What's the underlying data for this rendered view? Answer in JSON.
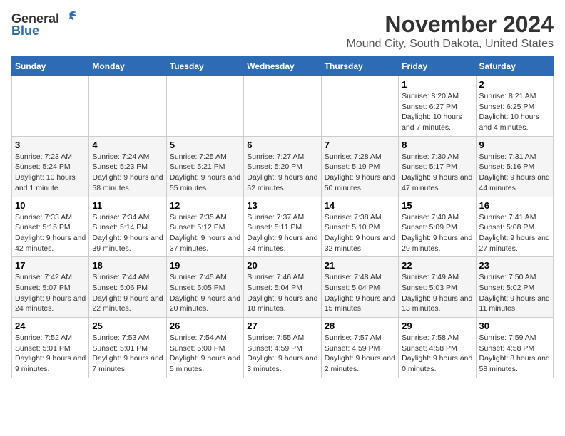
{
  "header": {
    "logo_general": "General",
    "logo_blue": "Blue",
    "month_year": "November 2024",
    "location": "Mound City, South Dakota, United States"
  },
  "weekdays": [
    "Sunday",
    "Monday",
    "Tuesday",
    "Wednesday",
    "Thursday",
    "Friday",
    "Saturday"
  ],
  "weeks": [
    [
      {
        "day": "",
        "info": ""
      },
      {
        "day": "",
        "info": ""
      },
      {
        "day": "",
        "info": ""
      },
      {
        "day": "",
        "info": ""
      },
      {
        "day": "",
        "info": ""
      },
      {
        "day": "1",
        "info": "Sunrise: 8:20 AM\nSunset: 6:27 PM\nDaylight: 10 hours and 7 minutes."
      },
      {
        "day": "2",
        "info": "Sunrise: 8:21 AM\nSunset: 6:25 PM\nDaylight: 10 hours and 4 minutes."
      }
    ],
    [
      {
        "day": "3",
        "info": "Sunrise: 7:23 AM\nSunset: 5:24 PM\nDaylight: 10 hours and 1 minute."
      },
      {
        "day": "4",
        "info": "Sunrise: 7:24 AM\nSunset: 5:23 PM\nDaylight: 9 hours and 58 minutes."
      },
      {
        "day": "5",
        "info": "Sunrise: 7:25 AM\nSunset: 5:21 PM\nDaylight: 9 hours and 55 minutes."
      },
      {
        "day": "6",
        "info": "Sunrise: 7:27 AM\nSunset: 5:20 PM\nDaylight: 9 hours and 52 minutes."
      },
      {
        "day": "7",
        "info": "Sunrise: 7:28 AM\nSunset: 5:19 PM\nDaylight: 9 hours and 50 minutes."
      },
      {
        "day": "8",
        "info": "Sunrise: 7:30 AM\nSunset: 5:17 PM\nDaylight: 9 hours and 47 minutes."
      },
      {
        "day": "9",
        "info": "Sunrise: 7:31 AM\nSunset: 5:16 PM\nDaylight: 9 hours and 44 minutes."
      }
    ],
    [
      {
        "day": "10",
        "info": "Sunrise: 7:33 AM\nSunset: 5:15 PM\nDaylight: 9 hours and 42 minutes."
      },
      {
        "day": "11",
        "info": "Sunrise: 7:34 AM\nSunset: 5:14 PM\nDaylight: 9 hours and 39 minutes."
      },
      {
        "day": "12",
        "info": "Sunrise: 7:35 AM\nSunset: 5:12 PM\nDaylight: 9 hours and 37 minutes."
      },
      {
        "day": "13",
        "info": "Sunrise: 7:37 AM\nSunset: 5:11 PM\nDaylight: 9 hours and 34 minutes."
      },
      {
        "day": "14",
        "info": "Sunrise: 7:38 AM\nSunset: 5:10 PM\nDaylight: 9 hours and 32 minutes."
      },
      {
        "day": "15",
        "info": "Sunrise: 7:40 AM\nSunset: 5:09 PM\nDaylight: 9 hours and 29 minutes."
      },
      {
        "day": "16",
        "info": "Sunrise: 7:41 AM\nSunset: 5:08 PM\nDaylight: 9 hours and 27 minutes."
      }
    ],
    [
      {
        "day": "17",
        "info": "Sunrise: 7:42 AM\nSunset: 5:07 PM\nDaylight: 9 hours and 24 minutes."
      },
      {
        "day": "18",
        "info": "Sunrise: 7:44 AM\nSunset: 5:06 PM\nDaylight: 9 hours and 22 minutes."
      },
      {
        "day": "19",
        "info": "Sunrise: 7:45 AM\nSunset: 5:05 PM\nDaylight: 9 hours and 20 minutes."
      },
      {
        "day": "20",
        "info": "Sunrise: 7:46 AM\nSunset: 5:04 PM\nDaylight: 9 hours and 18 minutes."
      },
      {
        "day": "21",
        "info": "Sunrise: 7:48 AM\nSunset: 5:04 PM\nDaylight: 9 hours and 15 minutes."
      },
      {
        "day": "22",
        "info": "Sunrise: 7:49 AM\nSunset: 5:03 PM\nDaylight: 9 hours and 13 minutes."
      },
      {
        "day": "23",
        "info": "Sunrise: 7:50 AM\nSunset: 5:02 PM\nDaylight: 9 hours and 11 minutes."
      }
    ],
    [
      {
        "day": "24",
        "info": "Sunrise: 7:52 AM\nSunset: 5:01 PM\nDaylight: 9 hours and 9 minutes."
      },
      {
        "day": "25",
        "info": "Sunrise: 7:53 AM\nSunset: 5:01 PM\nDaylight: 9 hours and 7 minutes."
      },
      {
        "day": "26",
        "info": "Sunrise: 7:54 AM\nSunset: 5:00 PM\nDaylight: 9 hours and 5 minutes."
      },
      {
        "day": "27",
        "info": "Sunrise: 7:55 AM\nSunset: 4:59 PM\nDaylight: 9 hours and 3 minutes."
      },
      {
        "day": "28",
        "info": "Sunrise: 7:57 AM\nSunset: 4:59 PM\nDaylight: 9 hours and 2 minutes."
      },
      {
        "day": "29",
        "info": "Sunrise: 7:58 AM\nSunset: 4:58 PM\nDaylight: 9 hours and 0 minutes."
      },
      {
        "day": "30",
        "info": "Sunrise: 7:59 AM\nSunset: 4:58 PM\nDaylight: 8 hours and 58 minutes."
      }
    ]
  ]
}
